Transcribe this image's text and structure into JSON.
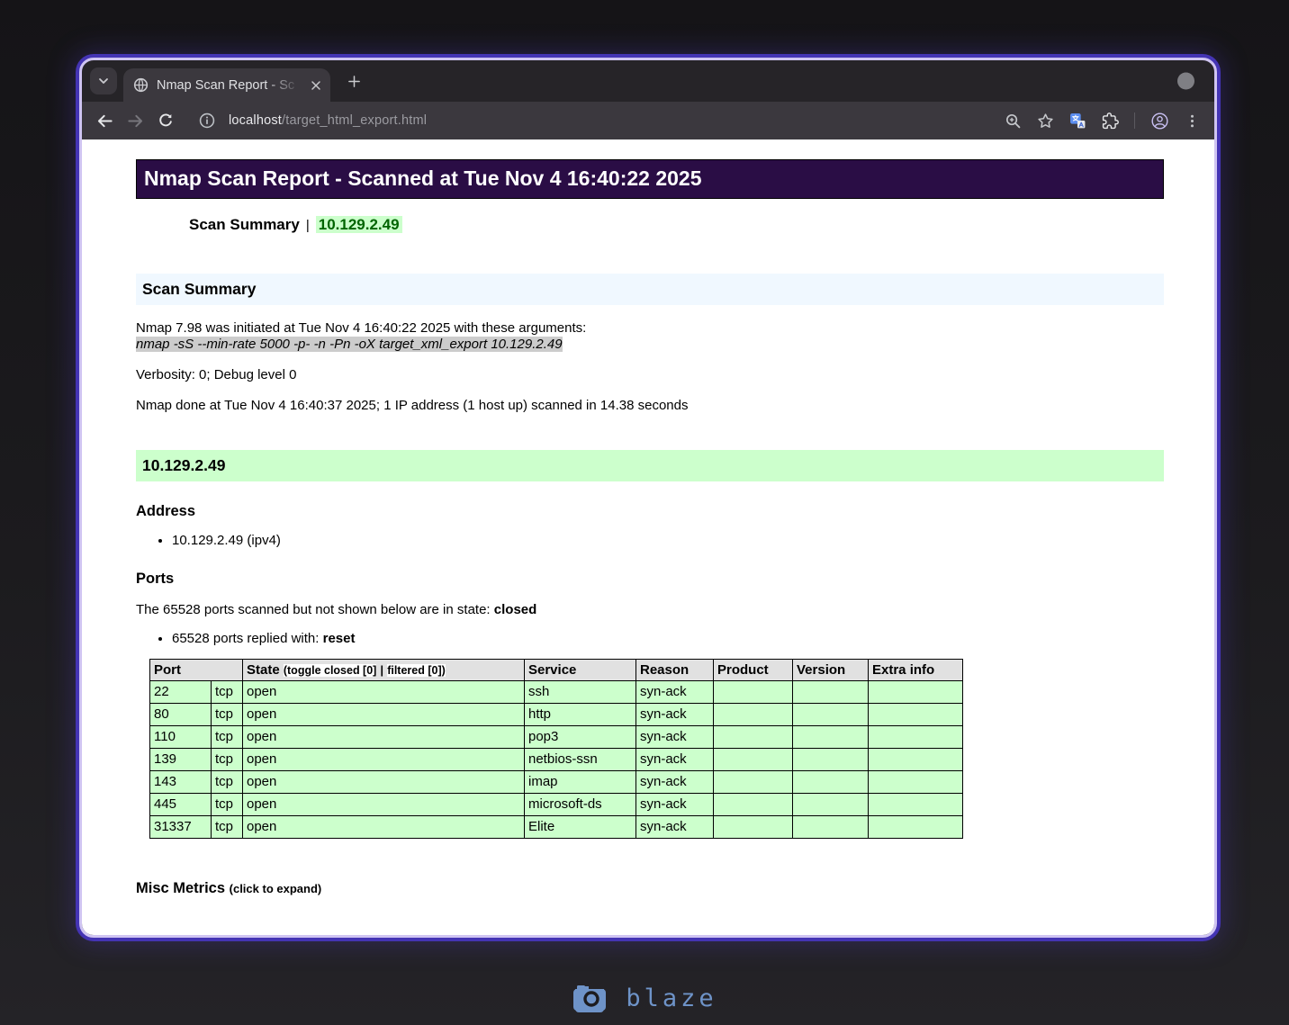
{
  "colors": {
    "title-bar-bg": "#2A0D45",
    "section-heading-bg": "#F0F8FF",
    "host-heading-bg": "#CCFFCC",
    "open-row-bg": "#CCFFCC",
    "table-head-bg": "#E1E1E1",
    "command-bg": "#CCCCCC",
    "host-link-color": "#006400",
    "window-border-inner": "#CFC4F2",
    "window-border-outer": "#4434B4",
    "watermark-color": "#6E93C8"
  },
  "browser": {
    "tab": {
      "title": "Nmap Scan Report - Sc"
    },
    "url": {
      "host": "localhost",
      "path": "/target_html_export.html"
    }
  },
  "page": {
    "title": "Nmap Scan Report - Scanned at Tue Nov 4 16:40:22 2025",
    "menu": {
      "summary_link": "Scan Summary",
      "separator": "|",
      "host_link": "10.129.2.49"
    },
    "scan_summary": {
      "heading": "Scan Summary",
      "initiated_line": "Nmap 7.98 was initiated at Tue Nov 4 16:40:22 2025 with these arguments:",
      "command": "nmap -sS --min-rate 5000 -p- -n -Pn -oX target_xml_export 10.129.2.49",
      "verbosity_line": "Verbosity: 0; Debug level 0",
      "done_line": "Nmap done at Tue Nov 4 16:40:37 2025; 1 IP address (1 host up) scanned in 14.38 seconds"
    },
    "host": {
      "heading": "10.129.2.49",
      "address_heading": "Address",
      "address_item": "10.129.2.49 (ipv4)",
      "ports_heading": "Ports",
      "ports_note_prefix": "The 65528 ports scanned but not shown below are in state: ",
      "ports_note_state": "closed",
      "ports_reply_prefix": "65528 ports replied with: ",
      "ports_reply_value": "reset",
      "table": {
        "headers": {
          "port": "Port",
          "state": "State",
          "toggle_closed": "(toggle closed [0]",
          "toggle_sep": "|",
          "toggle_filtered": "filtered [0])",
          "service": "Service",
          "reason": "Reason",
          "product": "Product",
          "version": "Version",
          "extra": "Extra info"
        },
        "columns_order": [
          "port",
          "proto",
          "state",
          "service",
          "reason",
          "product",
          "version",
          "extra"
        ],
        "rows": [
          {
            "port": "22",
            "proto": "tcp",
            "state": "open",
            "service": "ssh",
            "reason": "syn-ack",
            "product": "",
            "version": "",
            "extra": ""
          },
          {
            "port": "80",
            "proto": "tcp",
            "state": "open",
            "service": "http",
            "reason": "syn-ack",
            "product": "",
            "version": "",
            "extra": ""
          },
          {
            "port": "110",
            "proto": "tcp",
            "state": "open",
            "service": "pop3",
            "reason": "syn-ack",
            "product": "",
            "version": "",
            "extra": ""
          },
          {
            "port": "139",
            "proto": "tcp",
            "state": "open",
            "service": "netbios-ssn",
            "reason": "syn-ack",
            "product": "",
            "version": "",
            "extra": ""
          },
          {
            "port": "143",
            "proto": "tcp",
            "state": "open",
            "service": "imap",
            "reason": "syn-ack",
            "product": "",
            "version": "",
            "extra": ""
          },
          {
            "port": "445",
            "proto": "tcp",
            "state": "open",
            "service": "microsoft-ds",
            "reason": "syn-ack",
            "product": "",
            "version": "",
            "extra": ""
          },
          {
            "port": "31337",
            "proto": "tcp",
            "state": "open",
            "service": "Elite",
            "reason": "syn-ack",
            "product": "",
            "version": "",
            "extra": ""
          }
        ]
      },
      "misc_metrics": "Misc Metrics",
      "misc_metrics_hint": "(click to expand)"
    }
  },
  "watermark": {
    "label": "blaze"
  }
}
